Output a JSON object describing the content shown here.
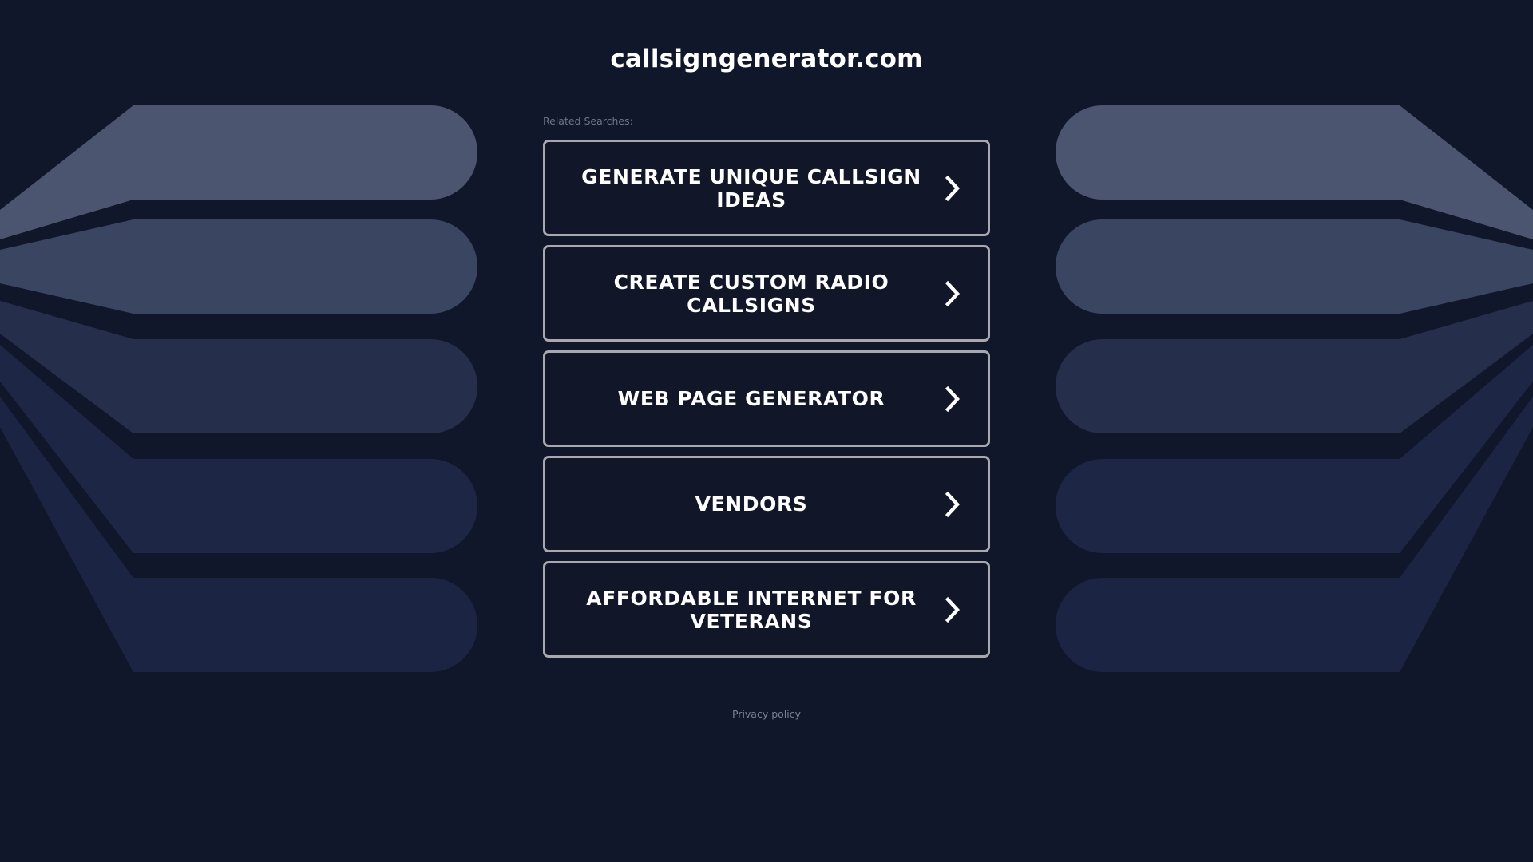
{
  "site": {
    "title": "callsigngenerator.com"
  },
  "related": {
    "label": "Related Searches:",
    "items": [
      {
        "label": "GENERATE UNIQUE CALLSIGN IDEAS"
      },
      {
        "label": "CREATE CUSTOM RADIO CALLSIGNS"
      },
      {
        "label": "WEB PAGE GENERATOR"
      },
      {
        "label": "VENDORS"
      },
      {
        "label": "AFFORDABLE INTERNET FOR VETERANS"
      }
    ]
  },
  "footer": {
    "privacy_label": "Privacy policy"
  },
  "icons": {
    "item_arrow": "chevron-right-icon"
  },
  "colors": {
    "background": "#11172b",
    "button_border": "#a8a8ae",
    "text": "#ffffff",
    "muted_text": "#6d7589"
  }
}
